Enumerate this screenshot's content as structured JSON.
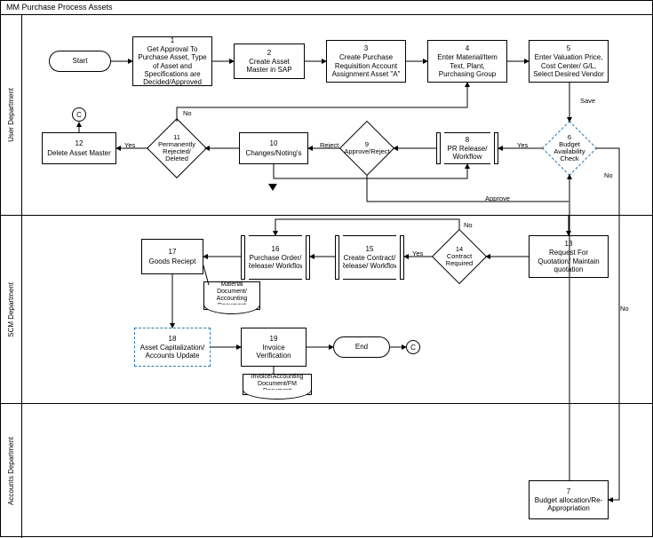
{
  "title": "MM Purchase Process Assets",
  "chart_data": {
    "type": "flowchart-swimlane",
    "title": "MM Purchase Process Assets",
    "lanes": [
      {
        "id": "user",
        "label": "User Department"
      },
      {
        "id": "scm",
        "label": "SCM Department"
      },
      {
        "id": "accounts",
        "label": "Accounts Department"
      }
    ],
    "nodes": [
      {
        "id": "start",
        "lane": "user",
        "type": "terminator",
        "label": "Start"
      },
      {
        "id": "1",
        "lane": "user",
        "type": "process",
        "num": "1",
        "label": "Get Approval To Purchase Asset, Type of Asset and Specifications are Decided/Approved"
      },
      {
        "id": "2",
        "lane": "user",
        "type": "process",
        "num": "2",
        "label": "Create Asset Master in SAP"
      },
      {
        "id": "3",
        "lane": "user",
        "type": "process",
        "num": "3",
        "label": "Create Purchase Requisition Account Assignment Asset \"A\""
      },
      {
        "id": "4",
        "lane": "user",
        "type": "process",
        "num": "4",
        "label": "Enter Material/Item Text, Plant, Purchasing Group"
      },
      {
        "id": "5",
        "lane": "user",
        "type": "process",
        "num": "5",
        "label": "Enter Valuation Price, Cost Center/ G/L, Select Desired Vendor"
      },
      {
        "id": "6",
        "lane": "user",
        "type": "decision",
        "style": "dashed",
        "num": "6",
        "label": "Budget Availability Check"
      },
      {
        "id": "8",
        "lane": "user",
        "type": "predefined-process",
        "num": "8",
        "label": "PR Release/ Workflow"
      },
      {
        "id": "9",
        "lane": "user",
        "type": "decision",
        "num": "9",
        "label": "Approve/Reject"
      },
      {
        "id": "10",
        "lane": "user",
        "type": "process",
        "num": "10",
        "label": "Changes/Noting's"
      },
      {
        "id": "11",
        "lane": "user",
        "type": "decision",
        "num": "11",
        "label": "Permanently Rejected/ Deleted"
      },
      {
        "id": "12",
        "lane": "user",
        "type": "process",
        "num": "12",
        "label": "Delete Asset Master"
      },
      {
        "id": "C1",
        "lane": "user",
        "type": "connector",
        "label": "C"
      },
      {
        "id": "13",
        "lane": "scm",
        "type": "process",
        "num": "13",
        "label": "Request For Quotation/ Maintain quotation"
      },
      {
        "id": "14",
        "lane": "scm",
        "type": "decision",
        "num": "14",
        "label": "Contract Required"
      },
      {
        "id": "15",
        "lane": "scm",
        "type": "predefined-process",
        "num": "15",
        "label": "Create Contract/ Release/ Workflow"
      },
      {
        "id": "16",
        "lane": "scm",
        "type": "predefined-process",
        "num": "16",
        "label": "Purchase Order/ Release/ Workflow"
      },
      {
        "id": "17",
        "lane": "scm",
        "type": "process",
        "num": "17",
        "label": "Goods Reciept"
      },
      {
        "id": "mdoc",
        "lane": "scm",
        "type": "document",
        "label": "Material Document/ Accounting Document"
      },
      {
        "id": "18",
        "lane": "scm",
        "type": "process",
        "style": "dashed",
        "num": "18",
        "label": "Asset Capitalization/ Accounts Update"
      },
      {
        "id": "19",
        "lane": "scm",
        "type": "process",
        "num": "19",
        "label": "Invoice Verification"
      },
      {
        "id": "idoc",
        "lane": "scm",
        "type": "document",
        "label": "Invoice/Accounting Document/FM Document"
      },
      {
        "id": "end",
        "lane": "scm",
        "type": "terminator",
        "label": "End"
      },
      {
        "id": "C2",
        "lane": "scm",
        "type": "connector",
        "label": "C"
      },
      {
        "id": "7",
        "lane": "accounts",
        "type": "process",
        "num": "7",
        "label": "Budget allocation/Re-Appropriation"
      }
    ],
    "edges": [
      {
        "from": "start",
        "to": "1"
      },
      {
        "from": "1",
        "to": "2"
      },
      {
        "from": "2",
        "to": "3"
      },
      {
        "from": "3",
        "to": "4"
      },
      {
        "from": "4",
        "to": "5"
      },
      {
        "from": "5",
        "to": "6",
        "label": "Save"
      },
      {
        "from": "6",
        "to": "8",
        "label": "Yes"
      },
      {
        "from": "6",
        "to": "7",
        "label": "No"
      },
      {
        "from": "7",
        "to": "6"
      },
      {
        "from": "8",
        "to": "9"
      },
      {
        "from": "9",
        "to": "10",
        "label": "Reject"
      },
      {
        "from": "9",
        "to": "13",
        "label": "Approve"
      },
      {
        "from": "10",
        "to": "11"
      },
      {
        "from": "10",
        "to": "8"
      },
      {
        "from": "11",
        "to": "12",
        "label": "Yes"
      },
      {
        "from": "11",
        "to": "4",
        "label": "No"
      },
      {
        "from": "12",
        "to": "C1"
      },
      {
        "from": "13",
        "to": "14"
      },
      {
        "from": "14",
        "to": "15",
        "label": "Yes"
      },
      {
        "from": "14",
        "to": "16",
        "label": "No"
      },
      {
        "from": "15",
        "to": "16"
      },
      {
        "from": "16",
        "to": "17"
      },
      {
        "from": "17",
        "to": "mdoc"
      },
      {
        "from": "17",
        "to": "18"
      },
      {
        "from": "18",
        "to": "19"
      },
      {
        "from": "19",
        "to": "idoc"
      },
      {
        "from": "19",
        "to": "end"
      },
      {
        "from": "end",
        "to": "C2"
      }
    ]
  },
  "lanes": {
    "user": "User Department",
    "scm": "SCM Department",
    "accounts": "Accounts Department"
  },
  "edge_labels": {
    "save": "Save",
    "yes": "Yes",
    "no": "No",
    "reject": "Reject",
    "approve": "Approve"
  },
  "n": {
    "start": "Start",
    "s1_num": "1",
    "s1": "Get Approval To Purchase Asset, Type of Asset and Specifications are Decided/Approved",
    "s2_num": "2",
    "s2": "Create Asset Master in SAP",
    "s3_num": "3",
    "s3": "Create Purchase Requisition Account Assignment Asset \"A\"",
    "s4_num": "4",
    "s4": "Enter Material/Item Text, Plant, Purchasing Group",
    "s5_num": "5",
    "s5": "Enter Valuation Price, Cost Center/ G/L, Select Desired Vendor",
    "s6_num": "6",
    "s6": "Budget Availability Check",
    "s7_num": "7",
    "s7": "Budget allocation/Re-Appropriation",
    "s8_num": "8",
    "s8": "PR Release/ Workflow",
    "s9_num": "9",
    "s9": "Approve/Reject",
    "s10_num": "10",
    "s10": "Changes/Noting's",
    "s11_num": "11",
    "s11": "Permanently Rejected/ Deleted",
    "s12_num": "12",
    "s12": "Delete Asset Master",
    "s13_num": "13",
    "s13": "Request For Quotation/ Maintain quotation",
    "s14_num": "14",
    "s14": "Contract Required",
    "s15_num": "15",
    "s15": "Create Contract/ Release/ Workflow",
    "s16_num": "16",
    "s16": "Purchase Order/ Release/ Workflow",
    "s17_num": "17",
    "s17": "Goods Reciept",
    "mdoc": "Material Document/ Accounting Document",
    "s18_num": "18",
    "s18": "Asset Capitalization/ Accounts Update",
    "s19_num": "19",
    "s19": "Invoice Verification",
    "idoc": "Invoice/Accounting Document/FM Document",
    "end": "End",
    "c": "C"
  }
}
